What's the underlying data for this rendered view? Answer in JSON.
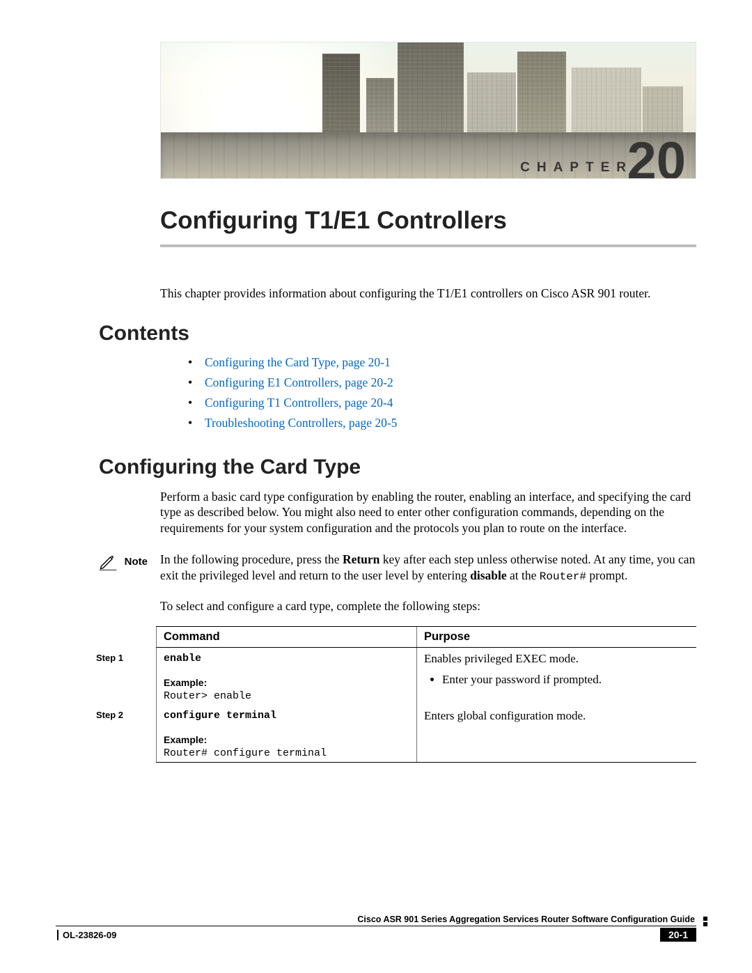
{
  "banner": {
    "chapter_label": "CHAPTER",
    "chapter_number": "20"
  },
  "chapter_title": "Configuring T1/E1 Controllers",
  "intro": "This chapter provides information about configuring the T1/E1 controllers on Cisco ASR 901 router.",
  "sections": {
    "contents_heading": "Contents",
    "configuring_heading": "Configuring the Card Type"
  },
  "toc": [
    "Configuring the Card Type, page 20-1",
    "Configuring E1 Controllers, page 20-2",
    "Configuring T1 Controllers, page 20-4",
    "Troubleshooting Controllers, page 20-5"
  ],
  "config_para": "Perform a basic card type configuration by enabling the router, enabling an interface, and specifying the card type as described below. You might also need to enter other configuration commands, depending on the requirements for your system configuration and the protocols you plan to route on the interface.",
  "note": {
    "label": "Note",
    "pre": "In the following procedure, press the ",
    "b1": "Return",
    "mid1": " key after each step unless otherwise noted. At any time, you can exit the privileged level and return to the user level by entering ",
    "b2": "disable",
    "mid2": " at the ",
    "code": "Router#",
    "post": " prompt."
  },
  "step_para": "To select and configure a card type, complete the following steps:",
  "table": {
    "headers": {
      "cmd": "Command",
      "purpose": "Purpose"
    },
    "example_label": "Example:",
    "rows": [
      {
        "step": "Step 1",
        "cmd": "enable",
        "example": "Router> enable",
        "purpose": "Enables privileged EXEC mode.",
        "purpose_bullets": [
          "Enter your password if prompted."
        ]
      },
      {
        "step": "Step 2",
        "cmd": "configure terminal",
        "example": "Router# configure terminal",
        "purpose": "Enters global configuration mode.",
        "purpose_bullets": []
      }
    ]
  },
  "footer": {
    "guide": "Cisco ASR 901 Series Aggregation Services Router Software Configuration Guide",
    "doc_id": "OL-23826-09",
    "page": "20-1"
  }
}
